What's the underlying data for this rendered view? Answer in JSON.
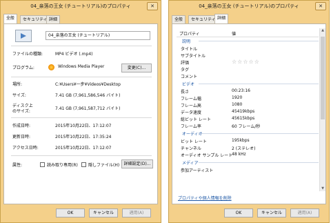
{
  "left": {
    "title": "04_亲落の王女 (チュートリアル)のプロパティ",
    "close": "✕",
    "tabs": [
      "全般",
      "セキュリティ",
      "詳細"
    ],
    "file_name": "04_亲落の王女 (チュートリアル)",
    "rows": {
      "type_label": "ファイルの種類:",
      "type_value": "MP4 ビデオ (.mp4)",
      "program_label": "プログラム:",
      "program_value": "Windows Media Player",
      "change_button": "変更(C)...",
      "location_label": "場所:",
      "location_value": "C:¥Users¥一步¥Videos¥Desktop",
      "size_label": "サイズ:",
      "size_value": "7.41 GB (7,961,586,546 バイト)",
      "disk_size_label_1": "ディスク上",
      "disk_size_label_2": "のサイズ:",
      "disk_size_value": "7.41 GB (7,961,587,712 バイト)",
      "created_label": "作成日時:",
      "created_value": "2015年10月22日、17:12:07",
      "modified_label": "更新日時:",
      "modified_value": "2015年10月22日、17:35:24",
      "accessed_label": "アクセス日時:",
      "accessed_value": "2015年10月22日、17:12:07",
      "attributes_label": "属性:",
      "readonly_label": "読み取り専用(R)",
      "hidden_label": "隠しファイル(H)",
      "advanced_button": "詳細設定(D)..."
    },
    "buttons": {
      "ok": "OK",
      "cancel": "キャンセル",
      "apply": "適用(A)"
    }
  },
  "right": {
    "title": "04_亲落の王女 (チュートリアル)のプロパティ",
    "close": "✕",
    "tabs": [
      "全般",
      "セキュリティ",
      "詳細"
    ],
    "header": {
      "property": "プロパティ",
      "value": "値"
    },
    "sections": {
      "description": "説明",
      "video": "ビデオ",
      "audio": "オーディオ",
      "media": "メディア"
    },
    "desc_rows": [
      {
        "prop": "タイトル",
        "val": ""
      },
      {
        "prop": "サブタイトル",
        "val": ""
      },
      {
        "prop": "評価",
        "val": ""
      },
      {
        "prop": "タグ",
        "val": ""
      },
      {
        "prop": "コメント",
        "val": ""
      }
    ],
    "rating_stars": "☆☆☆☆☆",
    "video_rows": [
      {
        "prop": "長さ",
        "val": "00:23:16"
      },
      {
        "prop": "フレーム幅",
        "val": "1920"
      },
      {
        "prop": "フレーム高",
        "val": "1080"
      },
      {
        "prop": "データ速度",
        "val": "45419kbps"
      },
      {
        "prop": "総ビット レート",
        "val": "45615kbps"
      },
      {
        "prop": "フレーム率",
        "val": "60 フレーム/秒"
      }
    ],
    "audio_rows": [
      {
        "prop": "ビット レート",
        "val": "195kbps"
      },
      {
        "prop": "チャンネル",
        "val": "2 (ステレオ)"
      },
      {
        "prop": "オーディオ サンプル レート",
        "val": "48 kHz"
      }
    ],
    "media_rows": [
      {
        "prop": "参加アーティスト",
        "val": ""
      }
    ],
    "remove_link": "プロパティや個人情報を削除",
    "buttons": {
      "ok": "OK",
      "cancel": "キャンセル",
      "apply": "適用(A)"
    }
  }
}
